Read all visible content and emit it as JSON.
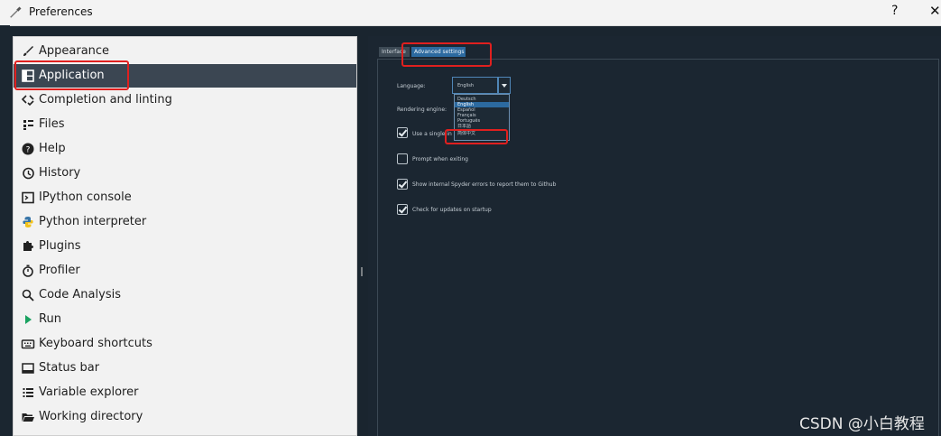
{
  "window": {
    "title": "Preferences",
    "help_button": "?",
    "close_button": "✕"
  },
  "sidebar": {
    "items": [
      {
        "label": "Appearance",
        "icon": "paintbrush-icon"
      },
      {
        "label": "Application",
        "icon": "layout-icon",
        "selected": true
      },
      {
        "label": "Completion and linting",
        "icon": "code-check-icon"
      },
      {
        "label": "Files",
        "icon": "files-icon"
      },
      {
        "label": "Help",
        "icon": "help-icon"
      },
      {
        "label": "History",
        "icon": "history-icon"
      },
      {
        "label": "IPython console",
        "icon": "console-icon"
      },
      {
        "label": "Python interpreter",
        "icon": "python-icon"
      },
      {
        "label": "Plugins",
        "icon": "puzzle-icon"
      },
      {
        "label": "Profiler",
        "icon": "stopwatch-icon"
      },
      {
        "label": "Code Analysis",
        "icon": "magnify-check-icon"
      },
      {
        "label": "Run",
        "icon": "play-icon"
      },
      {
        "label": "Keyboard shortcuts",
        "icon": "keyboard-icon"
      },
      {
        "label": "Status bar",
        "icon": "statusbar-icon"
      },
      {
        "label": "Variable explorer",
        "icon": "list-icon"
      },
      {
        "label": "Working directory",
        "icon": "folder-open-icon"
      }
    ]
  },
  "tabs": {
    "interface": "Interface",
    "advanced": "Advanced settings"
  },
  "advanced": {
    "language_label": "Language:",
    "language_value": "English",
    "language_options": [
      "Deutsch",
      "English",
      "Español",
      "Français",
      "Português",
      "日本語",
      "简体中文"
    ],
    "language_selected_index": 1,
    "rendering_label": "Rendering engine:",
    "single_instance_label": "Use a single in",
    "prompt_exit_label": "Prompt when exiting",
    "show_errors_label": "Show internal Spyder errors to report them to Github",
    "check_updates_label": "Check for updates on startup",
    "checks": {
      "single_instance": true,
      "prompt_exit": false,
      "show_errors": true,
      "check_updates": true
    }
  },
  "watermark": "CSDN @小白教程",
  "colors": {
    "highlight": "#e0201f",
    "selection": "#3b4652",
    "accent": "#2c6aa0",
    "panel": "#1b2631"
  }
}
